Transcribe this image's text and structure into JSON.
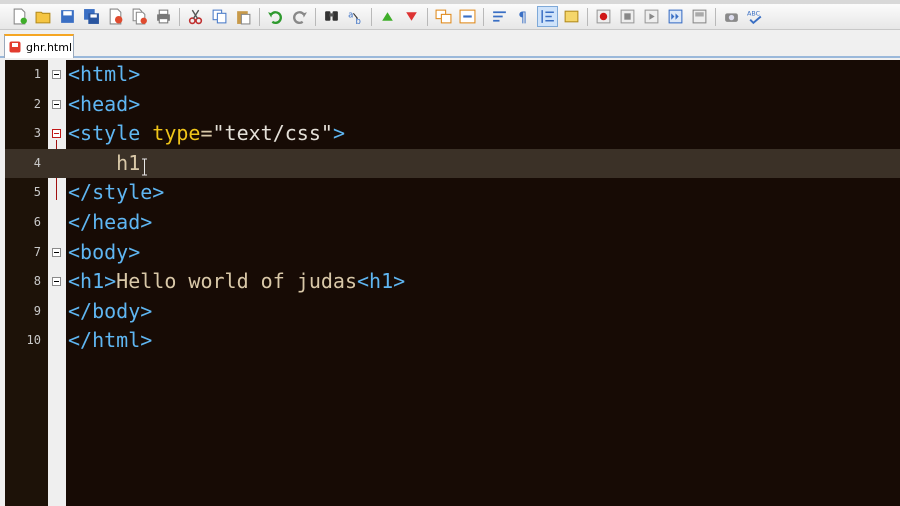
{
  "toolbar": {
    "icons": [
      "new-file-icon",
      "open-file-icon",
      "save-icon",
      "save-all-icon",
      "close-icon",
      "close-all-icon",
      "print-icon",
      "cut-icon",
      "copy-icon",
      "paste-icon",
      "undo-icon",
      "redo-icon",
      "find-icon",
      "replace-icon",
      "zoom-in-icon",
      "zoom-out-icon",
      "sync-vertical-icon",
      "sync-horizontal-icon",
      "word-wrap-icon",
      "show-all-chars-icon",
      "indent-guide-icon",
      "doc-map-icon",
      "record-macro-icon",
      "stop-macro-icon",
      "play-macro-icon",
      "run-macro-multiple-icon",
      "save-macro-icon",
      "launch-browser-icon",
      "spell-check-icon"
    ],
    "spellcheck_label": "ABC"
  },
  "tabs": [
    {
      "label": "ghr.html",
      "active": true
    }
  ],
  "editor": {
    "lines": [
      {
        "number": "1",
        "tokens": [
          [
            "tag",
            "<html>"
          ]
        ]
      },
      {
        "number": "2",
        "tokens": [
          [
            "tag",
            "<head>"
          ]
        ]
      },
      {
        "number": "3",
        "tokens": [
          [
            "tag",
            "<style "
          ],
          [
            "attr",
            "type"
          ],
          [
            "txt",
            "="
          ],
          [
            "str",
            "\"text/css\""
          ],
          [
            "tag",
            ">"
          ]
        ]
      },
      {
        "number": "4",
        "tokens": [
          [
            "txt",
            "    h1"
          ]
        ]
      },
      {
        "number": "5",
        "tokens": [
          [
            "tag",
            "</style>"
          ]
        ]
      },
      {
        "number": "6",
        "tokens": [
          [
            "tag",
            "</head>"
          ]
        ]
      },
      {
        "number": "7",
        "tokens": [
          [
            "tag",
            "<body>"
          ]
        ]
      },
      {
        "number": "8",
        "tokens": [
          [
            "tag",
            "<h1>"
          ],
          [
            "txt",
            "Hello world of judas"
          ],
          [
            "tag",
            "<h1>"
          ]
        ]
      },
      {
        "number": "9",
        "tokens": [
          [
            "tag",
            "</body>"
          ]
        ]
      },
      {
        "number": "10",
        "tokens": [
          [
            "tag",
            "</html>"
          ]
        ]
      }
    ],
    "current_line": 4
  },
  "colors": {
    "tag": "#5fb6f2",
    "attribute": "#f0c419",
    "string": "#e4e0d8",
    "text": "#d9c8a8",
    "background": "#170b05",
    "current_line": "#3b3127",
    "tab_accent": "#f5a623"
  }
}
